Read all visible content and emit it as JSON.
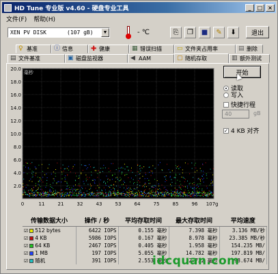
{
  "window": {
    "title": "HD Tune 专业版 v4.60 - 硬盘专业工具"
  },
  "menu": [
    "文件(F)",
    "帮助(H)"
  ],
  "toolbar": {
    "drive": "XEN   PV DISK",
    "capacity": "(107 gB)",
    "temp": "- ℃",
    "exit": "退出"
  },
  "tabs_row1": [
    {
      "label": "基准",
      "icon": "benchmark-icon"
    },
    {
      "label": "信息",
      "icon": "info-icon"
    },
    {
      "label": "健康",
      "icon": "health-icon"
    },
    {
      "label": "错误扫描",
      "icon": "error-scan-icon"
    },
    {
      "label": "文件夹占用率",
      "icon": "folder-usage-icon"
    },
    {
      "label": "删除",
      "icon": "erase-icon"
    }
  ],
  "tabs_row2": [
    {
      "label": "文件基准",
      "icon": "file-benchmark-icon"
    },
    {
      "label": "磁盘监视器",
      "icon": "disk-monitor-icon"
    },
    {
      "label": "AAM",
      "icon": "aam-icon"
    },
    {
      "label": "随机存取",
      "icon": "random-access-icon",
      "active": true
    },
    {
      "label": "额外测试",
      "icon": "extra-tests-icon"
    }
  ],
  "side": {
    "start": "开始",
    "read": "读取",
    "write": "写入",
    "quick": "快捷行程",
    "quick_value": "40",
    "quick_unit": "gB",
    "align": "4 KB 对齐"
  },
  "chart_data": {
    "type": "scatter",
    "ylabel": "毫秒",
    "ylim": [
      0,
      20
    ],
    "yticks": [
      "20.0",
      "18.0",
      "16.0",
      "14.0",
      "12.0",
      "10.0",
      "8.0",
      "6.0",
      "4.0",
      "2.0"
    ],
    "xlim": [
      0,
      107
    ],
    "xticks": [
      "0",
      "11",
      "21",
      "32",
      "43",
      "53",
      "64",
      "75",
      "85",
      "96",
      "107gB"
    ],
    "series_colors": [
      "#e8e800",
      "#c01010",
      "#20c020",
      "#2040ff",
      "#20c0c0"
    ],
    "density": {
      "y_min": 0.4,
      "y_max": 5.6,
      "peak_y": 1.0
    }
  },
  "stats": {
    "headers": [
      "传输数据大小",
      "操作 / 秒",
      "平均存取时间",
      "最大存取时间",
      "平均速度"
    ],
    "rows": [
      {
        "name": "512 bytes",
        "color": "#e8e800",
        "iops": "6422 IOPS",
        "avg": "0.155 毫秒",
        "max": "7.398 毫秒",
        "speed": "3.136 MB/秒"
      },
      {
        "name": "4 KB",
        "color": "#c01010",
        "iops": "5986 IOPS",
        "avg": "0.167 毫秒",
        "max": "8.978 毫秒",
        "speed": "23.385 MB/秒"
      },
      {
        "name": "64 KB",
        "color": "#20c020",
        "iops": "2467 IOPS",
        "avg": "0.405 毫秒",
        "max": "1.958 毫秒",
        "speed": "154.235 MB/"
      },
      {
        "name": "1 MB",
        "color": "#2040ff",
        "iops": "197 IOPS",
        "avg": "5.055 毫秒",
        "max": "14.782 毫秒",
        "speed": "197.819 MB/"
      },
      {
        "name": "随机",
        "color": "#20c0c0",
        "iops": "391 IOPS",
        "avg": "2.553 毫秒",
        "max": "12.732 毫秒",
        "speed": "198.674 MB/"
      }
    ]
  },
  "watermark": "idcquan.com"
}
